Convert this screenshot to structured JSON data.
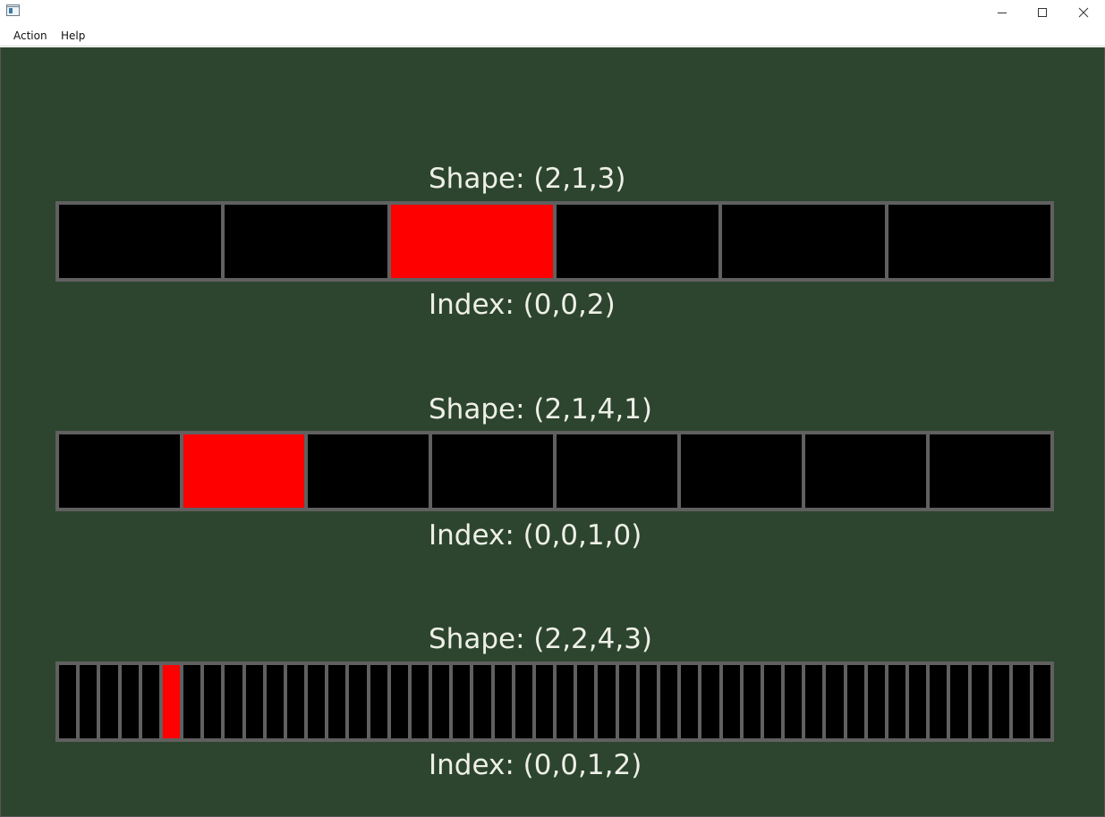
{
  "window": {
    "title": "",
    "icon": "app-window-icon",
    "controls": [
      "minimize-icon",
      "maximize-icon",
      "close-icon"
    ]
  },
  "menu": {
    "items": [
      {
        "label": "Action"
      },
      {
        "label": "Help"
      }
    ]
  },
  "colors": {
    "background": "#2d452e",
    "cell": "#000000",
    "highlight": "#ff0000",
    "grid": "#606060",
    "text": "#eef0e8"
  },
  "panels": [
    {
      "shape_label": "Shape: (2,1,3)",
      "index_label": "Index: (0,0,2)",
      "cell_count": 6,
      "highlight_cell": 2
    },
    {
      "shape_label": "Shape: (2,1,4,1)",
      "index_label": "Index: (0,0,1,0)",
      "cell_count": 8,
      "highlight_cell": 1
    },
    {
      "shape_label": "Shape: (2,2,4,3)",
      "index_label": "Index: (0,0,1,2)",
      "cell_count": 48,
      "highlight_cell": 5
    }
  ]
}
